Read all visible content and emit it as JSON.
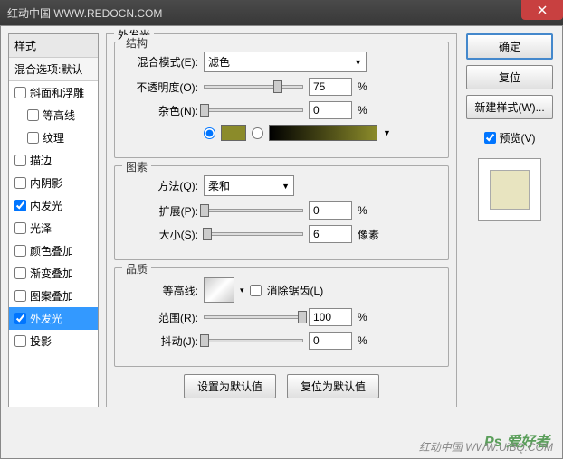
{
  "titlebar": {
    "text": "红动中国 WWW.REDOCN.COM"
  },
  "left": {
    "header": "样式",
    "sub": "混合选项:默认",
    "items": [
      {
        "label": "斜面和浮雕",
        "checked": false,
        "indent": false
      },
      {
        "label": "等高线",
        "checked": false,
        "indent": true
      },
      {
        "label": "纹理",
        "checked": false,
        "indent": true
      },
      {
        "label": "描边",
        "checked": false,
        "indent": false
      },
      {
        "label": "内阴影",
        "checked": false,
        "indent": false
      },
      {
        "label": "内发光",
        "checked": true,
        "indent": false
      },
      {
        "label": "光泽",
        "checked": false,
        "indent": false
      },
      {
        "label": "颜色叠加",
        "checked": false,
        "indent": false
      },
      {
        "label": "渐变叠加",
        "checked": false,
        "indent": false
      },
      {
        "label": "图案叠加",
        "checked": false,
        "indent": false
      },
      {
        "label": "外发光",
        "checked": true,
        "indent": false,
        "selected": true
      },
      {
        "label": "投影",
        "checked": false,
        "indent": false
      }
    ]
  },
  "center": {
    "outer_title": "外发光",
    "structure": {
      "title": "结构",
      "blend_label": "混合模式(E):",
      "blend_value": "滤色",
      "opacity_label": "不透明度(O):",
      "opacity_value": "75",
      "opacity_unit": "%",
      "noise_label": "杂色(N):",
      "noise_value": "0",
      "noise_unit": "%"
    },
    "elements": {
      "title": "图素",
      "method_label": "方法(Q):",
      "method_value": "柔和",
      "spread_label": "扩展(P):",
      "spread_value": "0",
      "spread_unit": "%",
      "size_label": "大小(S):",
      "size_value": "6",
      "size_unit": "像素"
    },
    "quality": {
      "title": "品质",
      "contour_label": "等高线:",
      "antialias_label": "消除锯齿(L)",
      "range_label": "范围(R):",
      "range_value": "100",
      "range_unit": "%",
      "jitter_label": "抖动(J):",
      "jitter_value": "0",
      "jitter_unit": "%"
    },
    "bottom": {
      "default": "设置为默认值",
      "reset": "复位为默认值"
    }
  },
  "right": {
    "ok": "确定",
    "cancel": "复位",
    "newstyle": "新建样式(W)...",
    "preview_label": "预览(V)"
  },
  "footer": "红动中国 WWW.UiBQ.COM",
  "watermark": "Ps 爱好者"
}
